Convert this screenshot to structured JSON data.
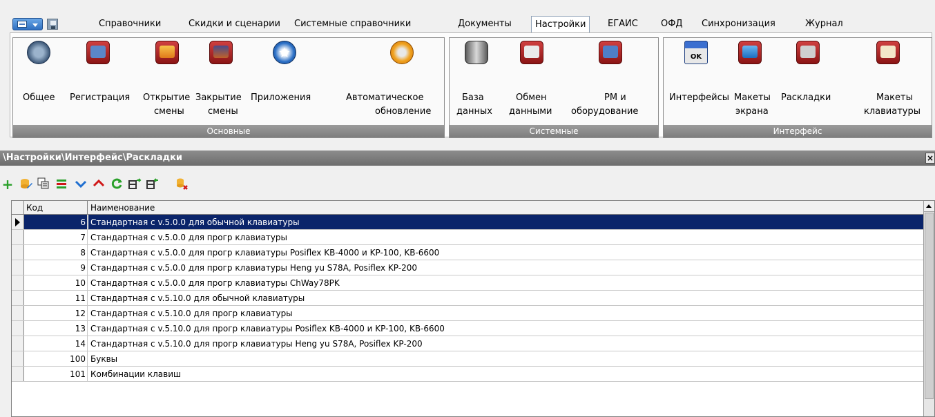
{
  "menu": {
    "items": [
      {
        "label": "Справочники"
      },
      {
        "label": "Скидки и сценарии"
      },
      {
        "label": "Системные справочники"
      },
      {
        "label": "Документы"
      },
      {
        "label": "Настройки"
      },
      {
        "label": "ЕГАИС"
      },
      {
        "label": "ОФД"
      },
      {
        "label": "Синхронизация"
      },
      {
        "label": "Журнал"
      }
    ],
    "active": "Настройки"
  },
  "ribbon": {
    "groups": [
      {
        "title": "Основные",
        "buttons": [
          {
            "line1": "Общее",
            "line2": "",
            "icon": "settings-gear-icon"
          },
          {
            "line1": "Регистрация",
            "line2": "",
            "icon": "registration-box-icon"
          },
          {
            "line1": "Открытие",
            "line2": "смены",
            "icon": "shift-open-icon"
          },
          {
            "line1": "Закрытие",
            "line2": "смены",
            "icon": "shift-close-icon"
          },
          {
            "line1": "Приложения",
            "line2": "",
            "icon": "star-icon"
          },
          {
            "line1": "Автоматическое",
            "line2": "обновление",
            "icon": "auto-update-icon"
          }
        ]
      },
      {
        "title": "Системные",
        "buttons": [
          {
            "line1": "База",
            "line2": "данных",
            "icon": "database-icon"
          },
          {
            "line1": "Обмен",
            "line2": "данными",
            "icon": "data-exchange-icon"
          },
          {
            "line1": "РМ и",
            "line2": "оборудование",
            "icon": "workstation-equipment-icon"
          }
        ]
      },
      {
        "title": "Интерфейс",
        "buttons": [
          {
            "line1": "Интерфейсы",
            "line2": "",
            "icon": "window-ok-icon"
          },
          {
            "line1": "Макеты",
            "line2": "экрана",
            "icon": "monitor-icon"
          },
          {
            "line1": "Раскладки",
            "line2": "",
            "icon": "keyboard-icon"
          },
          {
            "line1": "Макеты",
            "line2": "клавиатуры",
            "icon": "keypad-icon"
          }
        ]
      }
    ]
  },
  "path": "\\Настройки\\Интерфейс\\Раскладки",
  "close_label": "×",
  "toolbar": {
    "icons": [
      "add-icon",
      "edit-icon",
      "copy-icon",
      "delete-icon",
      "move-down-icon",
      "move-up-icon",
      "refresh-icon",
      "export-icon",
      "import-icon",
      "clear-icon"
    ]
  },
  "table": {
    "headers": {
      "code": "Код",
      "name": "Наименование"
    },
    "rows": [
      {
        "code": "6",
        "name": "Стандартная с v.5.0.0 для обычной клавиатуры"
      },
      {
        "code": "7",
        "name": "Стандартная с v.5.0.0 для прогр клавиатуры"
      },
      {
        "code": "8",
        "name": "Стандартная с v.5.0.0 для прогр клавиатуры Posiflex KB-4000 и KP-100, KB-6600"
      },
      {
        "code": "9",
        "name": "Стандартная с v.5.0.0 для прогр клавиатуры Heng yu S78A, Posiflex KP-200"
      },
      {
        "code": "10",
        "name": "Стандартная с v.5.0.0 для прогр клавиатуры ChWay78PK"
      },
      {
        "code": "11",
        "name": "Стандартная с v.5.10.0 для обычной клавиатуры"
      },
      {
        "code": "12",
        "name": "Стандартная с v.5.10.0 для прогр клавиатуры"
      },
      {
        "code": "13",
        "name": "Стандартная с v.5.10.0 для прогр клавиатуры Posiflex KB-4000 и KP-100, KB-6600"
      },
      {
        "code": "14",
        "name": "Стандартная с v.5.10.0 для прогр клавиатуры Heng yu S78A, Posiflex KP-200"
      },
      {
        "code": "100",
        "name": "Буквы"
      },
      {
        "code": "101",
        "name": "Комбинации клавиш"
      }
    ],
    "selected_row": 0
  },
  "colors": {
    "selection": "#0a246a",
    "group_title": "#8a8a8a",
    "add_green": "#2aa02a",
    "arrow_blue": "#1f6fd0",
    "arrow_red": "#d01818"
  }
}
